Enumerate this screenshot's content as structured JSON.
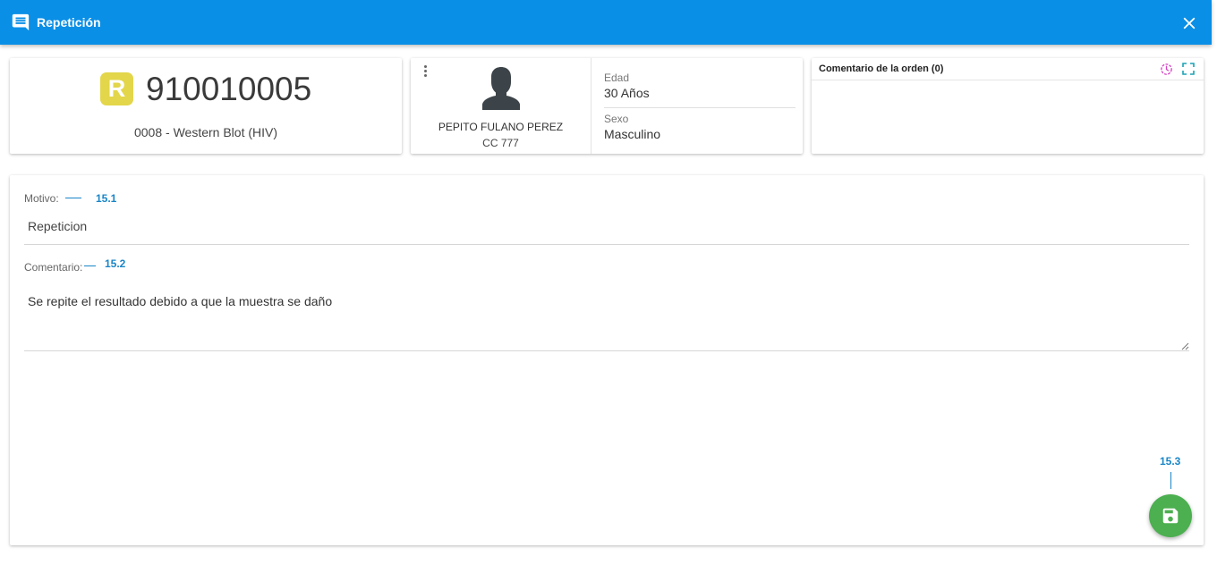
{
  "header": {
    "title": "Repetición",
    "title_icon": "comment-icon",
    "close_icon": "close-icon",
    "color": "#0a8fe6"
  },
  "order_card": {
    "badge": "R",
    "badge_color": "#e3d64a",
    "order_number": "910010005",
    "exam": "0008 - Western Blot (HIV)"
  },
  "patient_card": {
    "menu_icon": "more-vert-icon",
    "avatar_icon": "user-avatar-icon",
    "name": "PEPITO FULANO PEREZ",
    "document": "CC 777",
    "age_label": "Edad",
    "age_value": "30 Años",
    "sex_label": "Sexo",
    "sex_value": "Masculino"
  },
  "comment_card": {
    "title": "Comentario de la orden (0)",
    "history_icon": "history-icon",
    "history_color": "#d63fc4",
    "expand_icon": "fullscreen-icon",
    "expand_color": "#1aa3b5"
  },
  "form": {
    "motivo_label": "Motivo:",
    "motivo_value": "Repeticion",
    "comentario_label": "Comentario:",
    "comentario_value": "Se repite el resultado debido a que la muestra se daño",
    "save_icon": "save-icon",
    "save_color": "#4caf50"
  },
  "callouts": {
    "motivo": "15.1",
    "comentario": "15.2",
    "save": "15.3",
    "color": "#1a86c8"
  }
}
